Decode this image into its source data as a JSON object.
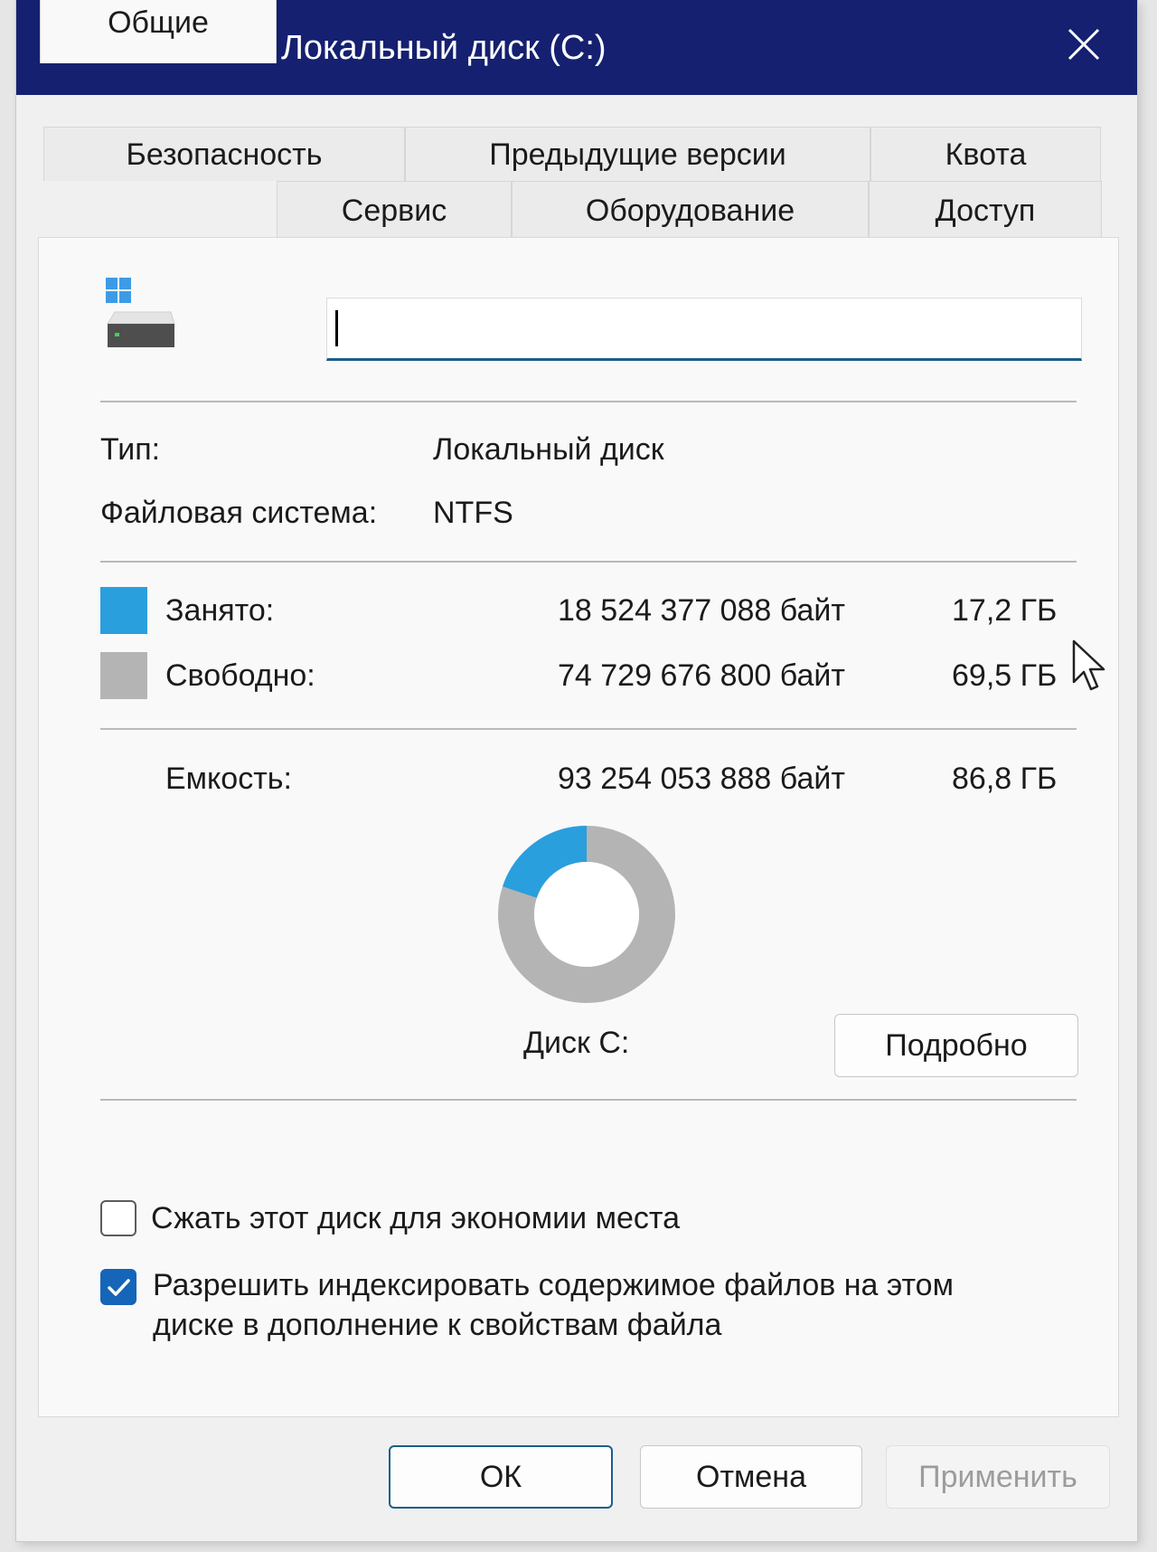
{
  "window": {
    "title": "Свойства: Локальный диск (C:)"
  },
  "tabs": {
    "row_back": [
      {
        "label": "Безопасность"
      },
      {
        "label": "Предыдущие версии"
      },
      {
        "label": "Квота"
      }
    ],
    "row_front": [
      {
        "label": "Общие",
        "selected": true
      },
      {
        "label": "Сервис"
      },
      {
        "label": "Оборудование"
      },
      {
        "label": "Доступ"
      }
    ]
  },
  "general": {
    "name_value": "",
    "type_label": "Тип:",
    "type_value": "Локальный диск",
    "fs_label": "Файловая система:",
    "fs_value": "NTFS",
    "used": {
      "label": "Занято:",
      "bytes": "18 524 377 088 байт",
      "size": "17,2 ГБ",
      "color": "#2a9fdd"
    },
    "free": {
      "label": "Свободно:",
      "bytes": "74 729 676 800 байт",
      "size": "69,5 ГБ",
      "color": "#b4b4b4"
    },
    "capacity": {
      "label": "Емкость:",
      "bytes": "93 254 053 888 байт",
      "size": "86,8 ГБ"
    },
    "used_fraction": 0.199,
    "disk_label": "Диск C:",
    "details_button": "Подробно",
    "compress_label": "Сжать этот диск для экономии места",
    "compress_checked": false,
    "index_label_line1": "Разрешить индексировать содержимое файлов на этом",
    "index_label_line2": "диске в дополнение к свойствам файла",
    "index_checked": true
  },
  "footer": {
    "ok_label": "ОК",
    "cancel_label": "Отмена",
    "apply_label": "Применить"
  },
  "colors": {
    "titlebar": "#152070",
    "accent": "#1c5e87",
    "checkbox_checked": "#1565b8"
  }
}
